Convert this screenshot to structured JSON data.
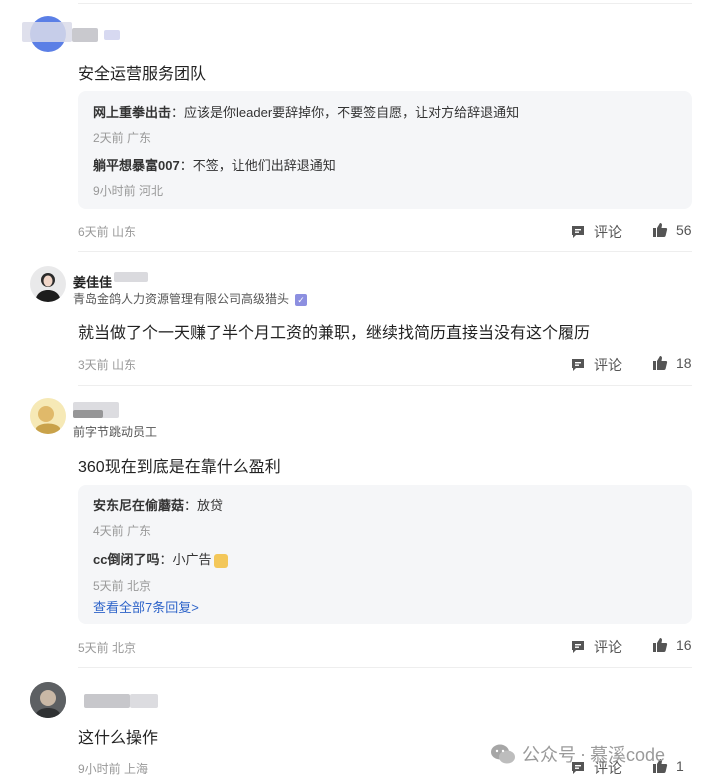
{
  "comments": [
    {
      "name": "",
      "text": "安全运营服务团队",
      "replies": [
        {
          "user": "网上重拳出击",
          "text": "应该是你leader要辞掉你，不要签自愿，让对方给辞退通知",
          "meta": "2天前 广东"
        },
        {
          "user": "躺平想暴富007",
          "text": "不签，让他们出辞退通知",
          "meta": "9小时前 河北"
        }
      ],
      "meta": "6天前 山东",
      "comment_label": "评论",
      "likes": "56"
    },
    {
      "name": "姜佳佳",
      "subtitle": "青岛金鸽人力资源管理有限公司高级猎头",
      "text": "就当做了个一天赚了半个月工资的兼职，继续找简历直接当没有这个履历",
      "meta": "3天前 山东",
      "comment_label": "评论",
      "likes": "18"
    },
    {
      "name": "",
      "subtitle": "前字节跳动员工",
      "text": "360现在到底是在靠什么盈利",
      "replies": [
        {
          "user": "安东尼在偷蘑菇",
          "text": "放贷",
          "meta": "4天前 广东"
        },
        {
          "user": "cc倒闭了吗",
          "text": "小广告",
          "meta": "5天前 北京"
        }
      ],
      "view_all": "查看全部7条回复>",
      "meta": "5天前 北京",
      "comment_label": "评论",
      "likes": "16"
    },
    {
      "name": "",
      "text": "这什么操作",
      "meta": "9小时前 上海",
      "comment_label": "评论",
      "likes": "1"
    }
  ],
  "watermark": {
    "brand": "公众号",
    "dot": "·",
    "name": "慕溪code"
  },
  "colors": {
    "link": "#2e64c9",
    "reply_bg": "#f5f6f8",
    "meta": "#999999"
  }
}
